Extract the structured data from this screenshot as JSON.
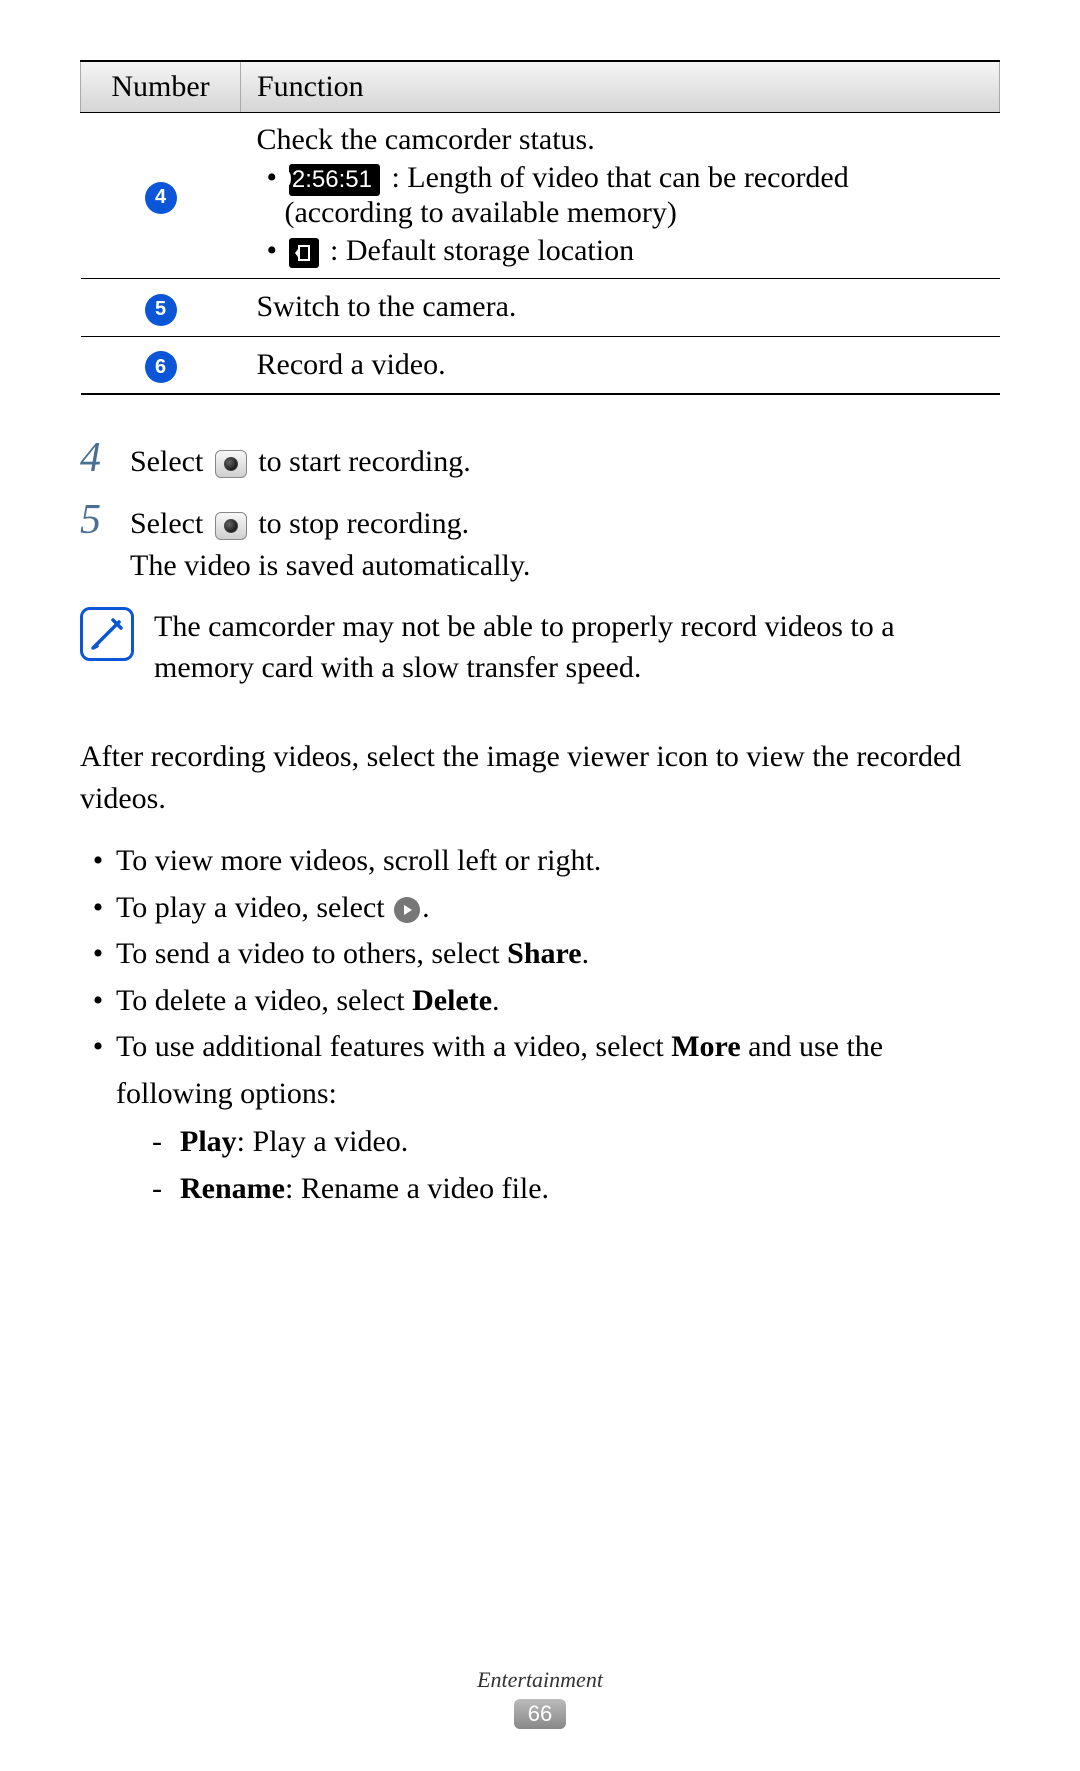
{
  "table": {
    "headers": {
      "number": "Number",
      "function": "Function"
    },
    "rows": {
      "r4": {
        "num": "4",
        "line1": "Check the camcorder status.",
        "time_badge": "02:56:51",
        "time_desc": " : Length of video that can be recorded (according to available memory)",
        "storage_desc": " : Default storage location"
      },
      "r5": {
        "num": "5",
        "func": "Switch to the camera."
      },
      "r6": {
        "num": "6",
        "func": "Record a video."
      }
    }
  },
  "steps": {
    "s4": {
      "num": "4",
      "pre": "Select ",
      "post": " to start recording."
    },
    "s5": {
      "num": "5",
      "pre": "Select ",
      "post": " to stop recording.",
      "line2": "The video is saved automatically."
    }
  },
  "note": "The camcorder may not be able to properly record videos to a memory card with a slow transfer speed.",
  "after": "After recording videos, select the image viewer icon to view the recorded videos.",
  "bullets": {
    "b1": "To view more videos, scroll left or right.",
    "b2_pre": "To play a video, select ",
    "b2_post": ".",
    "b3_pre": "To send a video to others, select ",
    "b3_bold": "Share",
    "b3_post": ".",
    "b4_pre": "To delete a video, select ",
    "b4_bold": "Delete",
    "b4_post": ".",
    "b5_pre": "To use additional features with a video, select ",
    "b5_bold": "More",
    "b5_post": " and use the following options:",
    "sub1_bold": "Play",
    "sub1_rest": ": Play a video.",
    "sub2_bold": "Rename",
    "sub2_rest": ": Rename a video file."
  },
  "footer": {
    "section": "Entertainment",
    "page": "66"
  }
}
